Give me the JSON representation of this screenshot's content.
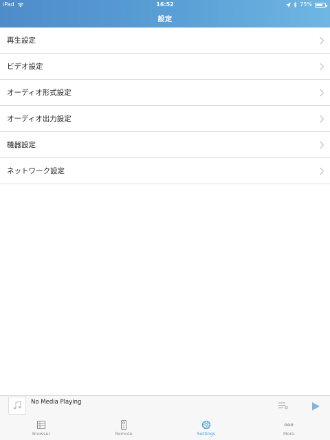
{
  "status_bar": {
    "device": "iPad",
    "time": "16:52",
    "battery": "75%",
    "battery_level": 0.75
  },
  "header": {
    "title": "設定"
  },
  "settings_list": [
    {
      "label": "再生設定"
    },
    {
      "label": "ビデオ設定"
    },
    {
      "label": "オーディオ形式設定"
    },
    {
      "label": "オーディオ出力設定"
    },
    {
      "label": "機器設定"
    },
    {
      "label": "ネットワーク設定"
    }
  ],
  "player": {
    "now_playing": "No Media Playing"
  },
  "tabs": [
    {
      "label": "Browser",
      "icon": "browser-icon"
    },
    {
      "label": "Remote",
      "icon": "remote-icon"
    },
    {
      "label": "Settings",
      "icon": "gear-icon",
      "active": true
    },
    {
      "label": "More",
      "icon": "more-icon"
    }
  ],
  "colors": {
    "accent": "#3d9ad9",
    "header_start": "#4e8cc9",
    "header_end": "#6fb6e3"
  }
}
